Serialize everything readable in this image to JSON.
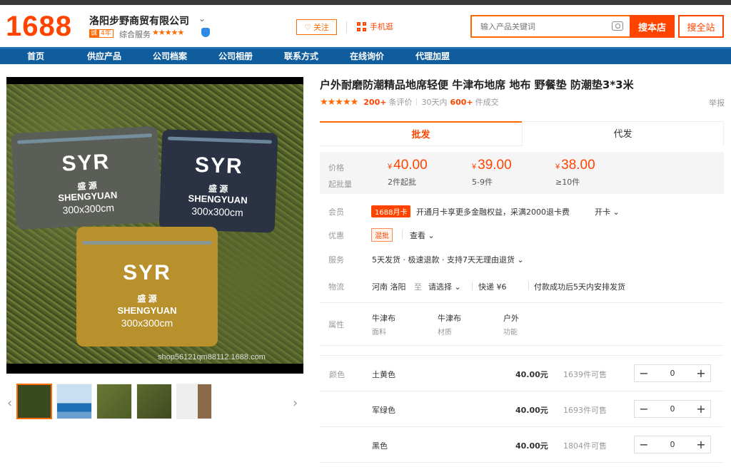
{
  "header": {
    "logo": "1688",
    "shop_name": "洛阳步野商贸有限公司",
    "badge_left": "诚",
    "badge_years": "4年",
    "overall_label": "综合服务",
    "overall_stars": "★★★★★",
    "follow_label": "关注",
    "mobile_label": "手机逛",
    "search_placeholder": "输入产品关键词",
    "search_shop_btn": "搜本店",
    "search_site_btn": "搜全站"
  },
  "nav": [
    "首页",
    "供应产品",
    "公司档案",
    "公司相册",
    "联系方式",
    "在线询价",
    "代理加盟"
  ],
  "gallery": {
    "bag_brand": "SYR",
    "bag_cn": "盛 源",
    "bag_name": "SHENGYUAN",
    "bag_size": "300x300cm",
    "watermark": "shop56121qm88112.1688.com"
  },
  "product": {
    "title": "户外耐磨防潮精品地席轻便 牛津布地席 地布 野餐垫 防潮垫3*3米",
    "stars": "★★★★★",
    "reviews_count": "200+",
    "reviews_label": "条评价",
    "sales_prefix": "30天内",
    "sales_count": "600+",
    "sales_label": "件成交",
    "report": "举报",
    "tabs": [
      "批发",
      "代发"
    ],
    "price_label": "价格",
    "moq_label": "起批量",
    "tiers": [
      {
        "currency": "¥",
        "price": "40.00",
        "qty": "2件起批"
      },
      {
        "currency": "¥",
        "price": "39.00",
        "qty": "5-9件"
      },
      {
        "currency": "¥",
        "price": "38.00",
        "qty": "≥10件"
      }
    ],
    "member_label": "会员",
    "vip_tag": "1688月卡",
    "vip_text": "开通月卡享更多金融权益，采满2000退卡费",
    "vip_open": "开卡 ⌄",
    "promo_label": "优惠",
    "mix_tag": "混批",
    "view_more": "查看 ⌄",
    "service_label": "服务",
    "service_text": "5天发货 · 极速退款 · 支持7天无理由退货 ⌄",
    "logistics_label": "物流",
    "logi_from": "河南 洛阳",
    "logi_to": "至",
    "logi_select": "请选择 ⌄",
    "logi_express": "快递 ¥6",
    "logi_note": "付款成功后5天内安排发货",
    "attr_label": "属性",
    "attrs": [
      {
        "value": "牛津布",
        "key": "面料"
      },
      {
        "value": "牛津布",
        "key": "材质"
      },
      {
        "value": "户外",
        "key": "功能"
      }
    ],
    "color_label": "颜色",
    "variants": [
      {
        "name": "土黄色",
        "price": "40.00元",
        "stock": "1639件可售",
        "qty": "0"
      },
      {
        "name": "军绿色",
        "price": "40.00元",
        "stock": "1693件可售",
        "qty": "0"
      },
      {
        "name": "黑色",
        "price": "40.00元",
        "stock": "1804件可售",
        "qty": "0"
      }
    ]
  }
}
